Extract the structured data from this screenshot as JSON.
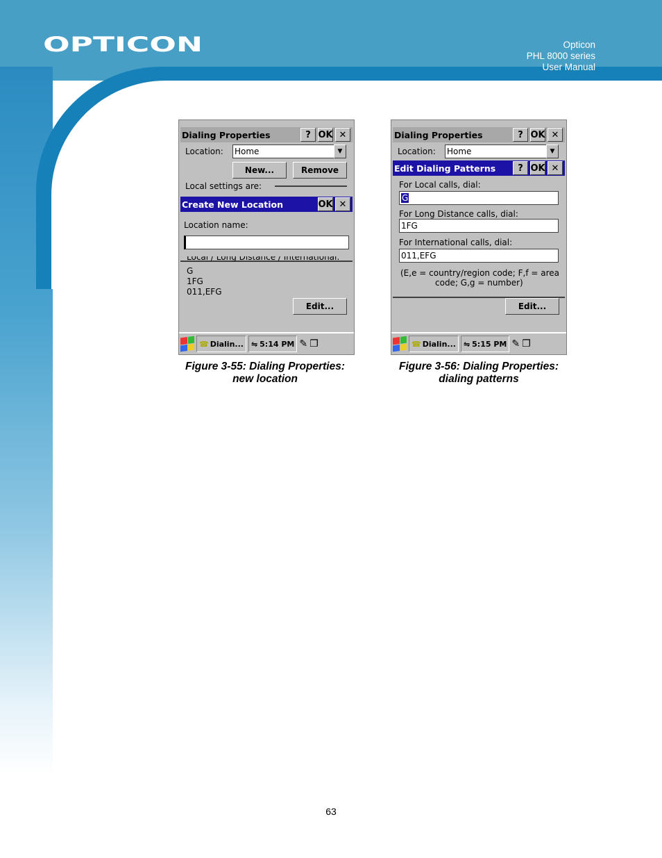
{
  "header": {
    "brand": "OPTICON",
    "lines": [
      "Opticon",
      "PHL 8000 series",
      "User Manual"
    ]
  },
  "colors": {
    "header_blue": "#479fc6",
    "title_blue": "#1c12a6",
    "window_gray": "#c0c0c0"
  },
  "figure1": {
    "window_title": "Dialing Properties",
    "help": "?",
    "ok": "OK",
    "close": "✕",
    "location_label": "Location:",
    "location_value": "Home",
    "new_button": "New...",
    "remove_button": "Remove",
    "local_settings": "Local settings are:",
    "dialog_title": "Create New Location",
    "name_label": "Location name:",
    "name_value": "",
    "partial_row": "Local / Long Distance / International:",
    "values": [
      "G",
      "1FG",
      "011,EFG"
    ],
    "edit_button": "Edit...",
    "taskbar_app": "Dialin...",
    "taskbar_time": "5:14 PM",
    "caption": [
      "Figure 3-55: Dialing Properties:",
      "new location"
    ]
  },
  "figure2": {
    "window_title": "Dialing Properties",
    "help": "?",
    "ok": "OK",
    "close": "✕",
    "location_label": "Location:",
    "location_value": "Home",
    "dialog_title": "Edit Dialing Patterns",
    "local_label": "For Local calls, dial:",
    "local_value": "G",
    "long_label": "For Long Distance calls, dial:",
    "long_value": "1FG",
    "intl_label": "For International calls, dial:",
    "intl_value": "011,EFG",
    "legend1": "(E,e = country/region code; F,f = area",
    "legend2": "code; G,g = number)",
    "edit_button": "Edit...",
    "taskbar_app": "Dialin...",
    "taskbar_time": "5:15 PM",
    "caption": [
      "Figure 3-56: Dialing Properties:",
      "dialing patterns"
    ]
  },
  "page_number": "63"
}
